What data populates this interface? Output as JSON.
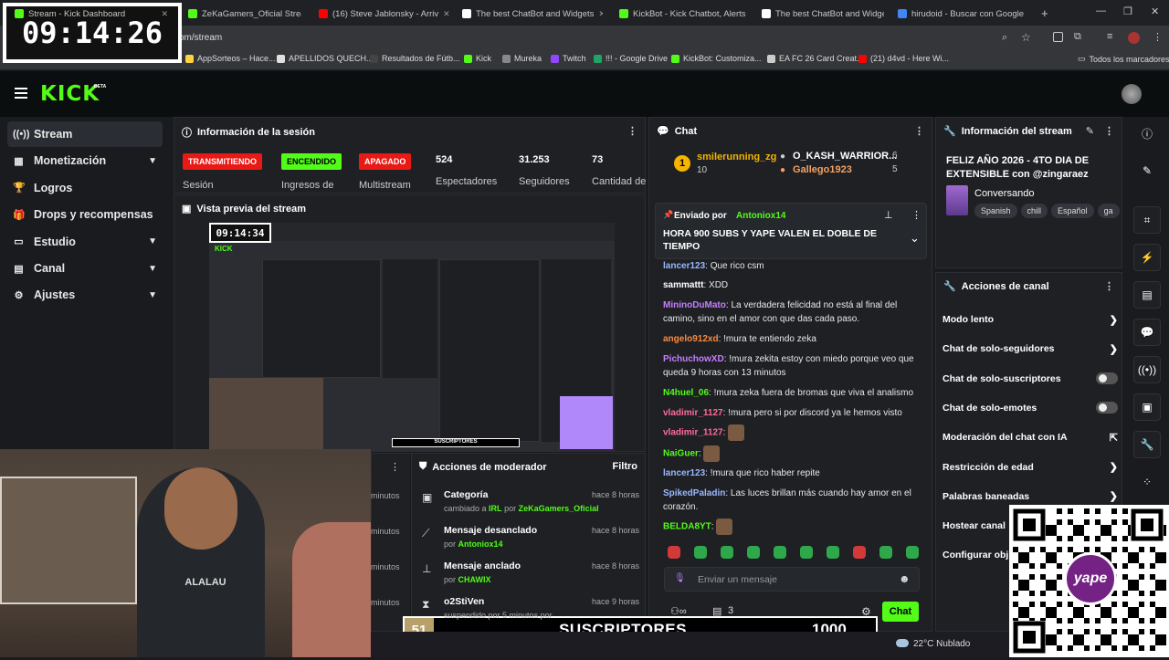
{
  "browser": {
    "tabs": [
      {
        "label": "Stream - Kick Dashboard",
        "color": "#53fc18"
      },
      {
        "label": "ZeKaGamers_Oficial Stream - W",
        "color": "#53fc18"
      },
      {
        "label": "(16) Steve Jablonsky - Arriv",
        "color": "#ff0000"
      },
      {
        "label": "The best ChatBot and Widgets",
        "color": "#ffffff"
      },
      {
        "label": "KickBot - Kick Chatbot, Alerts,",
        "color": "#53fc18"
      },
      {
        "label": "The best ChatBot and Widgets",
        "color": "#ffffff"
      },
      {
        "label": "hirudoid - Buscar con Google",
        "color": "#4285f4"
      }
    ],
    "url": "om/stream",
    "bookmarks": [
      {
        "label": "AppSorteos – Hace...",
        "color": "#ffd23f"
      },
      {
        "label": "APELLIDOS QUECH...",
        "color": "#e0e0e0"
      },
      {
        "label": "Resultados de Fútb...",
        "color": "#444444"
      },
      {
        "label": "Kick",
        "color": "#53fc18"
      },
      {
        "label": "Mureka",
        "color": "#888888"
      },
      {
        "label": "Twitch",
        "color": "#9146ff"
      },
      {
        "label": "!!! - Google Drive",
        "color": "#1fa463"
      },
      {
        "label": "KickBot: Customiza...",
        "color": "#53fc18"
      },
      {
        "label": "EA FC 26 Card Creat...",
        "color": "#cccccc"
      },
      {
        "label": "(21) d4vd - Here Wi...",
        "color": "#ff0000"
      }
    ],
    "all_bookmarks": "Todos los marcadores"
  },
  "timer": "09:14:26",
  "kick": {
    "logo": "KICK",
    "beta": "BETA",
    "sidebar": [
      {
        "label": "Stream",
        "icon": "stream-icon",
        "glyph": "((•))",
        "active": true,
        "chevron": false
      },
      {
        "label": "Monetización",
        "icon": "money-icon",
        "glyph": "▦",
        "active": false,
        "chevron": true
      },
      {
        "label": "Logros",
        "icon": "trophy-icon",
        "glyph": "🏆",
        "active": false,
        "chevron": false
      },
      {
        "label": "Drops y recompensas",
        "icon": "gift-icon",
        "glyph": "🎁",
        "active": false,
        "chevron": false
      },
      {
        "label": "Estudio",
        "icon": "studio-icon",
        "glyph": "▭",
        "active": false,
        "chevron": true
      },
      {
        "label": "Canal",
        "icon": "channel-icon",
        "glyph": "▤",
        "active": false,
        "chevron": true
      },
      {
        "label": "Ajustes",
        "icon": "settings-icon",
        "glyph": "⚙",
        "active": false,
        "chevron": true
      }
    ]
  },
  "session": {
    "title": "Información de la sesión",
    "badges": [
      {
        "text": "TRANSMITIENDO",
        "bg": "#e91916",
        "fg": "#ffffff",
        "label": "Sesión"
      },
      {
        "text": "ENCENDIDO",
        "bg": "#53fc18",
        "fg": "#000000",
        "label": "Ingresos de"
      },
      {
        "text": "APAGADO",
        "bg": "#e91916",
        "fg": "#ffffff",
        "label": "Multistream"
      }
    ],
    "stats": [
      {
        "value": "524",
        "label": "Espectadores"
      },
      {
        "value": "31.253",
        "label": "Seguidores"
      },
      {
        "value": "73",
        "label": "Cantidad de"
      }
    ]
  },
  "preview": {
    "title": "Vista previa del stream",
    "mini_timer": "09:14:34"
  },
  "chat": {
    "title": "Chat",
    "leaders": [
      {
        "rank": "1",
        "name": "smilerunning_zg",
        "value": "10"
      },
      {
        "name": "O_KASH_WARRIOR...",
        "value": "6"
      },
      {
        "name": "Gallego1923",
        "value": "5"
      }
    ],
    "pinned_by_label": "Enviado por",
    "pinned_by": "Antoniox14",
    "pinned_text": "HORA 900 SUBS Y YAPE VALEN EL DOBLE DE TIEMPO",
    "messages": [
      {
        "user": "lancer123",
        "color": "#9ab8ff",
        "text": "Que rico csm"
      },
      {
        "user": "sammattt",
        "color": "#ffffff",
        "text": "XDD"
      },
      {
        "user": "MininoDuMato",
        "color": "#c77dff",
        "text": "La verdadera felicidad no está al final del camino, sino en el amor con que das cada paso."
      },
      {
        "user": "angelo912xd",
        "color": "#ff8a3d",
        "text": "!mura te entiendo zeka"
      },
      {
        "user": "PichuchowXD",
        "color": "#c77dff",
        "text": "!mura zekita estoy con miedo porque veo que queda 9 horas con 13 minutos"
      },
      {
        "user": "N4huel_06",
        "color": "#53fc18",
        "text": "!mura zeka fuera de bromas que viva el analismo"
      },
      {
        "user": "vladimir_1127",
        "color": "#ff6b9a",
        "text": "!mura pero si por discord ya le hemos visto"
      },
      {
        "user": "vladimir_1127",
        "color": "#ff6b9a",
        "text": ""
      },
      {
        "user": "NaiGuer",
        "color": "#53fc18",
        "text": ""
      },
      {
        "user": "lancer123",
        "color": "#9ab8ff",
        "text": "!mura que rico haber repite"
      },
      {
        "user": "SpikedPaladin",
        "color": "#9ab8ff",
        "text": "Las luces brillan más cuando hay amor en el corazón."
      },
      {
        "user": "BELDA8YT",
        "color": "#53fc18",
        "text": ""
      }
    ],
    "input_placeholder": "Enviar un mensaje",
    "count": "3",
    "send": "Chat"
  },
  "mod": {
    "title": "Acciones de moderador",
    "filter": "Filtro",
    "rows": [
      {
        "icon": "category-icon",
        "glyph": "▣",
        "title": "Categoría",
        "pre": "cambiado a",
        "target": "IRL",
        "mid": "por",
        "by": "ZeKaGamers_Oficial",
        "time": "hace 8 horas"
      },
      {
        "icon": "unpin-icon",
        "glyph": "⟋",
        "title": "Mensaje desanclado",
        "pre": "por",
        "target": "Antoniox14",
        "mid": "",
        "by": "",
        "time": "hace 8 horas"
      },
      {
        "icon": "pin-icon",
        "glyph": "⊥",
        "title": "Mensaje anclado",
        "pre": "por",
        "target": "CHAWIX",
        "mid": "",
        "by": "",
        "time": "hace 8 horas"
      },
      {
        "icon": "timeout-icon",
        "glyph": "⧗",
        "title": "o2StiVen",
        "pre": "suspendido por 5 minutos por",
        "target": "",
        "mid": "",
        "by": "",
        "time": "hace 9 horas"
      }
    ],
    "side_labels": [
      "minutos",
      "minutos",
      "minutos",
      "minutos"
    ]
  },
  "stream_info": {
    "title": "Información del stream",
    "stream_title": "FELIZ AÑO 2026 - 4TO DIA DE EXTENSIBLE con @zingaraez",
    "category": "Conversando",
    "tags": [
      "Spanish",
      "chill",
      "Español",
      "ga"
    ]
  },
  "channel_actions": {
    "title": "Acciones de canal",
    "items": [
      {
        "label": "Modo lento",
        "kind": "arrow"
      },
      {
        "label": "Chat de solo-seguidores",
        "kind": "arrow"
      },
      {
        "label": "Chat de solo-suscriptores",
        "kind": "toggle"
      },
      {
        "label": "Chat de solo-emotes",
        "kind": "toggle"
      },
      {
        "label": "Moderación del chat con IA",
        "kind": "external"
      },
      {
        "label": "Restricción de edad",
        "kind": "arrow"
      },
      {
        "label": "Palabras baneadas",
        "kind": "arrow"
      },
      {
        "label": "Hostear canal",
        "kind": "none"
      },
      {
        "label": "Configurar obj",
        "kind": "none"
      }
    ]
  },
  "overlay": {
    "sub_count": "51",
    "sub_label": "SUSCRIPTORES",
    "sub_goal": "1000",
    "weather": "22°C  Nublado",
    "yape": "yape"
  }
}
